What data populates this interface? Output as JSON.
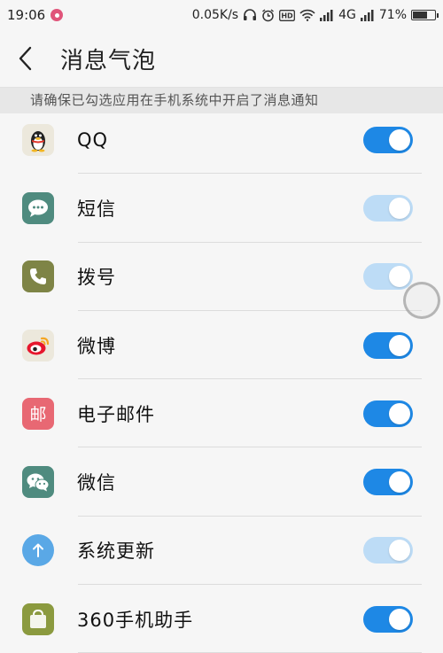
{
  "status_bar": {
    "time": "19:06",
    "network_speed": "0.05K/s",
    "signal_label": "4G",
    "battery_percent": "71%",
    "battery_level": 0.71,
    "icons": [
      "record-icon",
      "headphones-icon",
      "alarm-icon",
      "hd-icon",
      "wifi-icon",
      "signal-icon",
      "battery-icon"
    ]
  },
  "header": {
    "back_icon": "chevron-left-icon",
    "title": "消息气泡"
  },
  "hint": "请确保已勾选应用在手机系统中开启了消息通知",
  "apps": [
    {
      "id": "qq",
      "label": "QQ",
      "icon": "qq-penguin-icon",
      "icon_bg": "#ece8dc",
      "enabled": true,
      "toggle_state": "on"
    },
    {
      "id": "sms",
      "label": "短信",
      "icon": "sms-bubble-icon",
      "icon_bg": "#4f8b7f",
      "enabled": false,
      "toggle_state": "on"
    },
    {
      "id": "dialer",
      "label": "拨号",
      "icon": "phone-icon",
      "icon_bg": "#7e8446",
      "enabled": false,
      "toggle_state": "on"
    },
    {
      "id": "weibo",
      "label": "微博",
      "icon": "weibo-icon",
      "icon_bg": "#ece8dc",
      "enabled": true,
      "toggle_state": "on"
    },
    {
      "id": "email",
      "label": "电子邮件",
      "icon": "email-icon",
      "icon_bg": "#e86873",
      "enabled": true,
      "toggle_state": "on"
    },
    {
      "id": "wechat",
      "label": "微信",
      "icon": "wechat-icon",
      "icon_bg": "#4f8b7f",
      "enabled": true,
      "toggle_state": "on"
    },
    {
      "id": "update",
      "label": "系统更新",
      "icon": "update-arrow-icon",
      "icon_bg": "#5aa8e6",
      "enabled": false,
      "toggle_state": "on"
    },
    {
      "id": "assistant",
      "label": "360手机助手",
      "icon": "shopping-bag-icon",
      "icon_bg": "#8b9a3f",
      "enabled": true,
      "toggle_state": "on"
    }
  ],
  "colors": {
    "toggle_on": "#1e88e5",
    "toggle_disabled": "#bddcf6",
    "background": "#f6f6f6",
    "hint_bg": "#e7e7e7"
  }
}
